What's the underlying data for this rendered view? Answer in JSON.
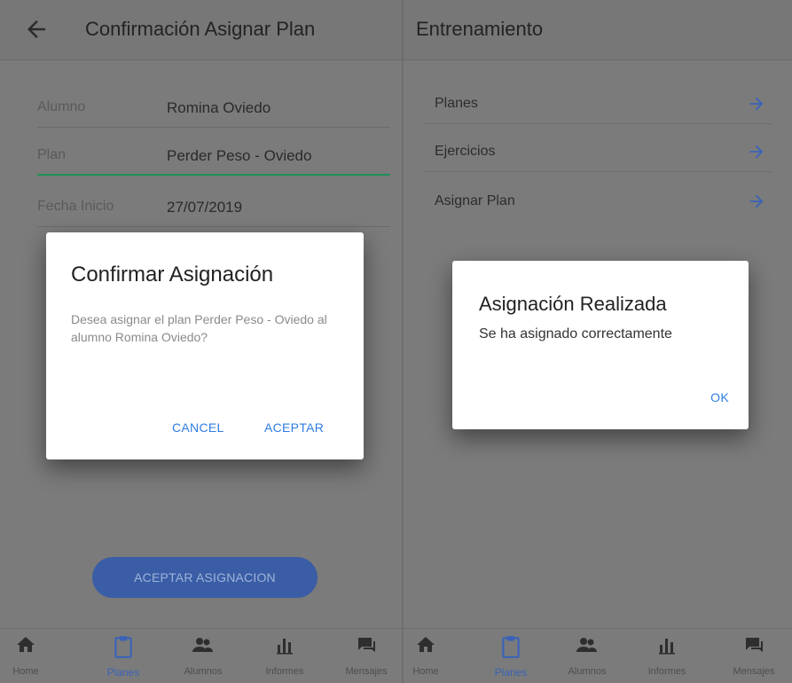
{
  "left": {
    "title": "Confirmación Asignar Plan",
    "fields": [
      {
        "label": "Alumno",
        "value": "Romina Oviedo"
      },
      {
        "label": "Plan",
        "value": "Perder Peso - Oviedo"
      },
      {
        "label": "Fecha Inicio",
        "value": "27/07/2019"
      }
    ],
    "primary_button": "ACEPTAR ASIGNACION",
    "dialog": {
      "title": "Confirmar Asignación",
      "body": "Desea asignar el plan Perder Peso - Oviedo al alumno Romina Oviedo?",
      "cancel": "CANCEL",
      "accept": "ACEPTAR"
    }
  },
  "right": {
    "title": "Entrenamiento",
    "menu": [
      {
        "label": "Planes"
      },
      {
        "label": "Ejercicios"
      },
      {
        "label": "Asignar Plan"
      }
    ],
    "dialog": {
      "title": "Asignación Realizada",
      "body": "Se ha asignado correctamente",
      "ok": "OK"
    }
  },
  "nav": {
    "items": [
      {
        "label": "Home",
        "icon": "home-icon"
      },
      {
        "label": "Planes",
        "icon": "clipboard-icon",
        "active": true
      },
      {
        "label": "Alumnos",
        "icon": "people-icon"
      },
      {
        "label": "Informes",
        "icon": "bar-chart-icon"
      },
      {
        "label": "Mensajes",
        "icon": "chat-icon"
      }
    ]
  },
  "colors": {
    "accent": "#2f7de1",
    "active_nav": "#3a63b7",
    "field_focus": "#1e8f57"
  }
}
